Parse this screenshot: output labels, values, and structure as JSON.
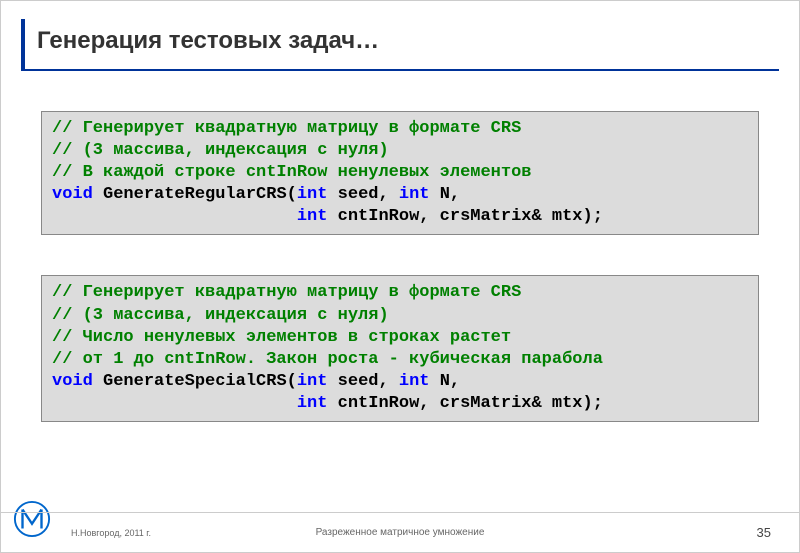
{
  "header": {
    "title": "Генерация тестовых задач…"
  },
  "code1": {
    "c1": "// Генерирует квадратную матрицу в формате CRS",
    "c2": "// (3 массива, индексация с нуля)",
    "c3": "// В каждой строке cntInRow ненулевых элементов",
    "kw_void": "void",
    "fn": " GenerateRegularCRS(",
    "kw_int1": "int",
    "p1": " seed, ",
    "kw_int2": "int",
    "p2": " N,",
    "indent": "                        ",
    "kw_int3": "int",
    "p3": " cntInRow, crsMatrix& mtx);"
  },
  "code2": {
    "c1": "// Генерирует квадратную матрицу в формате CRS",
    "c2": "// (3 массива, индексация с нуля)",
    "c3": "// Число ненулевых элементов в строках растет",
    "c4": "// от 1 до cntInRow. Закон роста - кубическая парабола",
    "kw_void": "void",
    "fn": " GenerateSpecialCRS(",
    "kw_int1": "int",
    "p1": " seed, ",
    "kw_int2": "int",
    "p2": " N,",
    "indent": "                        ",
    "kw_int3": "int",
    "p3": " cntInRow, crsMatrix& mtx);"
  },
  "footer": {
    "location": "Н.Новгород, 2011 г.",
    "title": "Разреженное матричное умножение",
    "page": "35"
  }
}
